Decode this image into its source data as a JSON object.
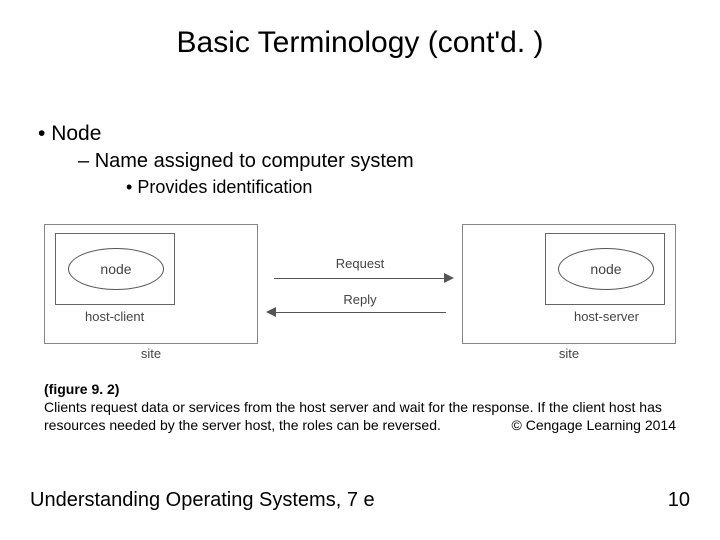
{
  "title": "Basic Terminology (cont'd. )",
  "bullets": {
    "l1": "Node",
    "l2": "Name assigned to computer system",
    "l3": "Provides identification"
  },
  "diagram": {
    "node_left": "node",
    "node_right": "node",
    "host_left": "host-client",
    "host_right": "host-server",
    "site_left": "site",
    "site_right": "site",
    "request": "Request",
    "reply": "Reply"
  },
  "caption": {
    "figref": "(figure 9. 2)",
    "text": "Clients request data or services from the host server and wait for the response. If the client host has resources needed by the server host, the roles can be reversed.",
    "copyright": "© Cengage Learning 2014"
  },
  "footer": {
    "book": "Understanding Operating Systems, 7 e",
    "page": "10"
  }
}
